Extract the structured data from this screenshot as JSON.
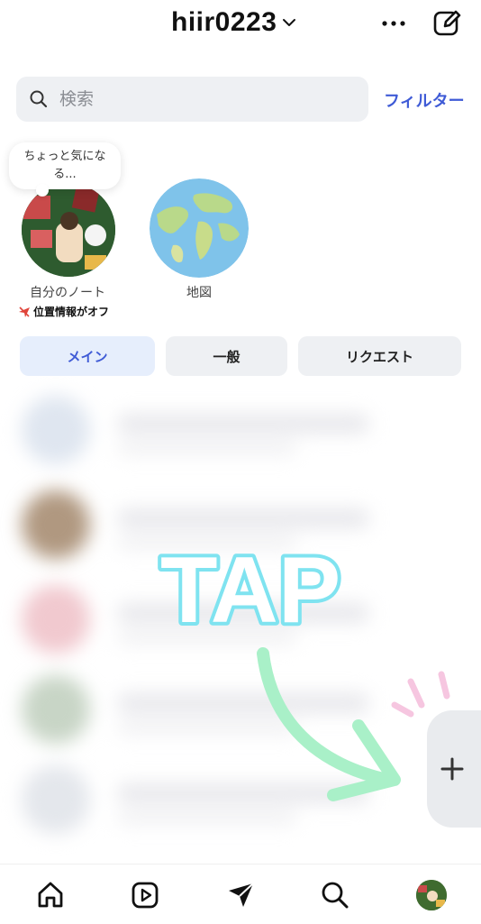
{
  "header": {
    "account_name": "hiir0223",
    "icons": {
      "chevron": "chevron-down-icon",
      "more": "more-horizontal-icon",
      "compose": "compose-icon"
    }
  },
  "search": {
    "placeholder": "検索",
    "filter_label": "フィルター"
  },
  "notes": {
    "my_note": {
      "bubble_text_line1": "ちょっと気にな",
      "bubble_text_line2": "る...",
      "label": "自分のノート",
      "location_status": "位置情報がオフ"
    },
    "map": {
      "label": "地図"
    }
  },
  "tabs": [
    {
      "label": "メイン",
      "active": true
    },
    {
      "label": "一般",
      "active": false
    },
    {
      "label": "リクエスト",
      "active": false
    }
  ],
  "overlay": {
    "text": "TAP"
  },
  "bottom_nav": {
    "items": [
      "home-icon",
      "reels-icon",
      "messages-icon",
      "search-icon",
      "profile-avatar"
    ]
  },
  "colors": {
    "accent": "#3f5bd6",
    "tap_text": "#7fe3f0",
    "arrow": "#a9f0c8",
    "sparkle": "#f6c6e0"
  }
}
